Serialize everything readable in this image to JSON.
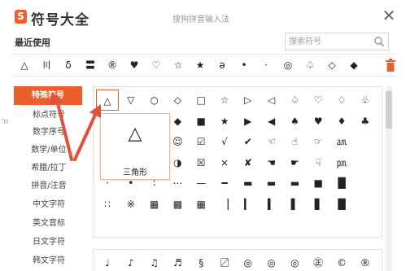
{
  "app": {
    "logo_glyph": "S",
    "title": "符号大全",
    "input_hint": "搜狗拼音输入法",
    "close_glyph": "✕"
  },
  "recent": {
    "label": "最近使用",
    "search_placeholder": "搜索符号",
    "symbols": [
      "△",
      "〣",
      "δ",
      "〓",
      "®",
      "♥",
      "♡",
      "☆",
      "★",
      "ə",
      "•",
      "·",
      "◎",
      "♤",
      "◇",
      "◆"
    ]
  },
  "sidebar": {
    "items": [
      {
        "label": "特殊符号",
        "active": true
      },
      {
        "label": "标点符号",
        "active": false
      },
      {
        "label": "数字序号",
        "active": false
      },
      {
        "label": "数学/单位",
        "active": false
      },
      {
        "label": "希腊/拉丁",
        "active": false
      },
      {
        "label": "拼音/注音",
        "active": false
      },
      {
        "label": "中文字符",
        "active": false
      },
      {
        "label": "英文音标",
        "active": false
      },
      {
        "label": "日文字符",
        "active": false
      },
      {
        "label": "韩文字符",
        "active": false
      }
    ]
  },
  "grid": {
    "rows": [
      [
        "△",
        "▽",
        "○",
        "◇",
        "□",
        "☆",
        "▷",
        "◁",
        "♤",
        "♡",
        "♢",
        "♧"
      ],
      [
        "▲",
        "▼",
        "●",
        "◆",
        "■",
        "★",
        "▶",
        "◀",
        "♠",
        "♥",
        "♦",
        "♣"
      ],
      [
        "☼",
        "☽",
        "☺",
        "☺",
        "☑",
        "√",
        "✔",
        "☜",
        "☝",
        "☞",
        "㏂",
        ""
      ],
      [
        "☀",
        "☾",
        "☹",
        "◑",
        "☒",
        "×",
        "✘",
        "☚",
        "☛",
        "☟",
        "㏘",
        ""
      ],
      [
        "·",
        "•",
        "∶",
        "⋯",
        "—",
        "━",
        "▬",
        "▬",
        "▬",
        "■",
        "█",
        ""
      ],
      [
        "∷",
        "※",
        "▦",
        "▩",
        "▦",
        "▕",
        "▎",
        "▍",
        "▌",
        "▋",
        "█",
        ""
      ]
    ],
    "bottom_row": [
      "♩",
      "♪",
      "♫",
      "♬",
      "§",
      "〼",
      "◎",
      "◎",
      "◎",
      "㊣",
      "©",
      "®"
    ],
    "selected": {
      "symbol": "△",
      "name": "三角形"
    }
  },
  "colors": {
    "accent": "#ec5f2c",
    "grid_border": "#e0e0e0",
    "arrow": "#e0503a"
  },
  "edge_text": "'n"
}
